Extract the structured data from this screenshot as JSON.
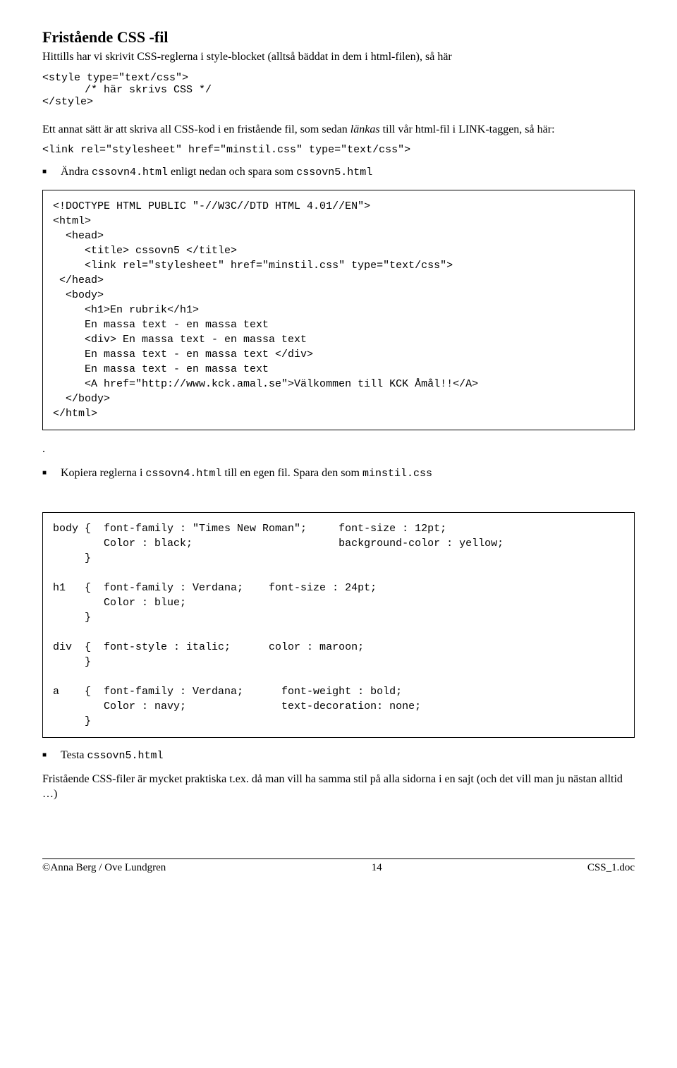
{
  "heading": "Fristående CSS -fil",
  "intro": "Hittills har vi skrivit CSS-reglerna i style-blocket (alltså bäddat in dem i  html-filen), så här",
  "style_open": "<style type=\"text/css\">",
  "style_comment": "/*  här skrivs CSS */",
  "style_close": "</style>",
  "link_intro_1": "Ett annat sätt är att skriva all CSS-kod i en fristående fil, som sedan ",
  "link_intro_italic": "länkas",
  "link_intro_2": " till vår html-fil i LINK-taggen, så här:",
  "link_code": "<link rel=\"stylesheet\" href=\"minstil.css\" type=\"text/css\">",
  "bullet1_a": "Ändra  ",
  "bullet1_code1": "cssovn4.html",
  "bullet1_b": " enligt nedan och spara som ",
  "bullet1_code2": "cssovn5.html",
  "codebox1": "<!DOCTYPE HTML PUBLIC \"-//W3C//DTD HTML 4.01//EN\">\n<html>\n  <head>\n     <title> cssovn5 </title>\n     <link rel=\"stylesheet\" href=\"minstil.css\" type=\"text/css\">\n </head>\n  <body>\n     <h1>En rubrik</h1>\n     En massa text - en massa text\n     <div> En massa text - en massa text\n     En massa text - en massa text </div>\n     En massa text - en massa text\n     <A href=\"http://www.kck.amal.se\">Välkommen till KCK Åmål!!</A>\n  </body>\n</html>",
  "dot": ".",
  "bullet2_a": "Kopiera reglerna i ",
  "bullet2_code1": "cssovn4.html",
  "bullet2_b": "  till en egen fil. Spara den som  ",
  "bullet2_code2": "minstil.css",
  "codebox2": "body {  font-family : \"Times New Roman\";     font-size : 12pt;\n        Color : black;                       background-color : yellow;\n     }\n\nh1   {  font-family : Verdana;    font-size : 24pt;\n        Color : blue;\n     }\n\ndiv  {  font-style : italic;      color : maroon;\n     }\n\na    {  font-family : Verdana;      font-weight : bold;\n        Color : navy;               text-decoration: none;\n     }",
  "bullet3_a": "Testa ",
  "bullet3_code1": "cssovn5.html",
  "closing": "Fristående CSS-filer är mycket praktiska t.ex. då man vill ha samma stil på alla sidorna i en sajt (och det vill man ju nästan alltid …)",
  "footer_left": "©Anna Berg / Ove Lundgren",
  "footer_mid": "14",
  "footer_right": "CSS_1.doc"
}
